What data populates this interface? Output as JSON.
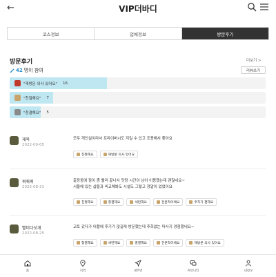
{
  "header": {
    "title": "VIP더바디"
  },
  "tabs": [
    "코스정보",
    "업체정보",
    "방문후기"
  ],
  "reviews_section": {
    "title": "방문후기",
    "more": "더보기 >",
    "count": "42",
    "count_suffix": "명이 참여",
    "write_label": "리뷰쓰기"
  },
  "stats": [
    {
      "label": "\"재방문 의사 있어요\"",
      "count": "16",
      "ratio": 0.38,
      "icon_color": "#c0392b"
    },
    {
      "label": "\"친절해요\"",
      "count": "7",
      "ratio": 0.17,
      "icon_color": "#c9a46a"
    },
    {
      "label": "\"청결해요\"",
      "count": "5",
      "ratio": 0.12,
      "icon_color": "#8a8a8a"
    }
  ],
  "reviews": [
    {
      "name": "재욱",
      "date": "2022-09-05",
      "text": "모두 개인실이라서 프라이버시도 지킬 수 있고 조용해서 좋아요",
      "tags": [
        "친절해요",
        "재방문 의사 있어요"
      ]
    },
    {
      "name": "쿼쿼쿼",
      "date": "2022-08-31",
      "text": "출장중에 잠이 좀 빨리 끝나서 맛땅 시간이 남아 이용했는데 괜찮네요~\n서울에 있는 샵들과 비교해봐도 시설도 그렇고 정말이 었었어요",
      "tags": [
        "친절해요",
        "청결해요",
        "세련해요",
        "전문적이에요",
        "주차가 편해요"
      ]
    },
    {
      "name": "빨미다섯개",
      "date": "2022-08-25",
      "text": "교토 갔다가 어플에 후기가 많길래 방문했는데 후회없는 마사지 경험했네요~",
      "tags": [
        "청결해요",
        "세련해요",
        "출결해요",
        "전문적이에요",
        "재방문 의사 있어요"
      ]
    }
  ],
  "bottom_nav": [
    {
      "label": "홈",
      "icon": "home-icon"
    },
    {
      "label": "지역",
      "icon": "location-icon"
    },
    {
      "label": "내주변",
      "icon": "send-icon"
    },
    {
      "label": "커뮤니티",
      "icon": "chat-icon"
    },
    {
      "label": "내정보",
      "icon": "user-icon"
    }
  ]
}
